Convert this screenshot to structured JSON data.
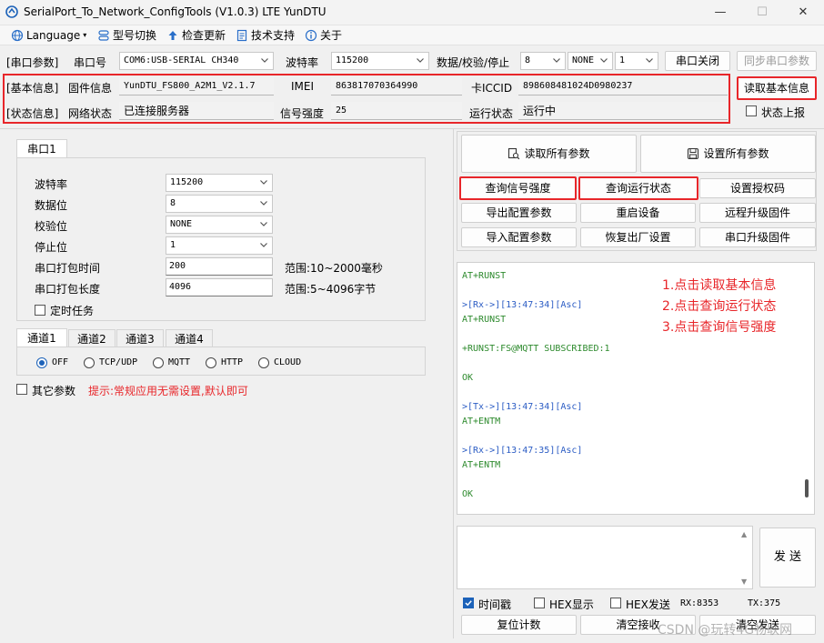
{
  "window": {
    "title": "SerialPort_To_Network_ConfigTools (V1.0.3) LTE YunDTU",
    "minimize": "—",
    "maximize": "☐",
    "close": "✕"
  },
  "menu": {
    "language": "Language",
    "model_switch": "型号切换",
    "check_update": "检查更新",
    "tech_support": "技术支持",
    "about": "关于"
  },
  "serial_params": {
    "section": "[串口参数]",
    "port_label": "串口号",
    "port_value": "COM6:USB-SERIAL CH340",
    "baud_label": "波特率",
    "baud_value": "115200",
    "dps_label": "数据/校验/停止",
    "data_bits": "8",
    "parity": "NONE",
    "stop_bits": "1",
    "close_port_button": "串口关闭",
    "sync_button": "同步串口参数"
  },
  "basic_info": {
    "section": "[基本信息]",
    "firmware_label": "固件信息",
    "firmware_value": "YunDTU_FS800_A2M1_V2.1.7",
    "imei_label": "IMEI",
    "imei_value": "863817070364990",
    "iccid_label": "卡ICCID",
    "iccid_value": "898608481024D0980237",
    "read_button": "读取基本信息"
  },
  "status_info": {
    "section": "[状态信息]",
    "network_label": "网络状态",
    "network_value": "已连接服务器",
    "signal_label": "信号强度",
    "signal_value": "25",
    "run_label": "运行状态",
    "run_value": "运行中",
    "report_label": "状态上报"
  },
  "serial_tab": {
    "tab": "串口1",
    "baud_label": "波特率",
    "baud_value": "115200",
    "data_label": "数据位",
    "data_value": "8",
    "parity_label": "校验位",
    "parity_value": "NONE",
    "stop_label": "停止位",
    "stop_value": "1",
    "pack_time_label": "串口打包时间",
    "pack_time_value": "200",
    "pack_time_range": "范围:10~2000毫秒",
    "pack_len_label": "串口打包长度",
    "pack_len_value": "4096",
    "pack_len_range": "范围:5~4096字节",
    "timer_task_label": "定时任务"
  },
  "channels": {
    "tabs": [
      "通道1",
      "通道2",
      "通道3",
      "通道4"
    ],
    "options": [
      "OFF",
      "TCP/UDP",
      "MQTT",
      "HTTP",
      "CLOUD"
    ],
    "selected": "OFF",
    "other_params_label": "其它参数",
    "hint": "提示:常规应用无需设置,默认即可"
  },
  "actions": {
    "read_all": "读取所有参数",
    "set_all": "设置所有参数",
    "query_signal": "查询信号强度",
    "query_status": "查询运行状态",
    "set_auth": "设置授权码",
    "export_config": "导出配置参数",
    "restart": "重启设备",
    "remote_upgrade": "远程升级固件",
    "import_config": "导入配置参数",
    "factory_reset": "恢复出厂设置",
    "serial_upgrade": "串口升级固件"
  },
  "log": {
    "lines": [
      {
        "text": "AT+RUNST",
        "color": "green"
      },
      {
        "text": ">[Rx->][13:47:34][Asc]",
        "color": "blue"
      },
      {
        "text": "AT+RUNST",
        "color": "green"
      },
      {
        "text": "+RUNST:FS@MQTT SUBSCRIBED:1",
        "color": "green"
      },
      {
        "text": "OK",
        "color": "green"
      },
      {
        "text": ">[Tx->][13:47:34][Asc]",
        "color": "blue"
      },
      {
        "text": "AT+ENTM",
        "color": "green"
      },
      {
        "text": ">[Rx->][13:47:35][Asc]",
        "color": "blue"
      },
      {
        "text": "AT+ENTM",
        "color": "green"
      },
      {
        "text": "OK",
        "color": "green"
      }
    ],
    "notes": [
      "1.点击读取基本信息",
      "2.点击查询运行状态",
      "3.点击查询信号强度"
    ]
  },
  "send": {
    "button": "发 送",
    "timestamp_label": "时间戳",
    "hex_display_label": "HEX显示",
    "hex_send_label": "HEX发送",
    "rx": "RX:8353",
    "tx": "TX:375",
    "reset_count": "复位计数",
    "clear_recv": "清空接收",
    "clear_send": "清空发送"
  },
  "watermark": "CSDN @玩转4G物联网",
  "colors": {
    "highlight": "#e8262a",
    "log_green": "#2d8a2d",
    "log_blue": "#2b5cc4",
    "accent": "#1c62b9"
  }
}
